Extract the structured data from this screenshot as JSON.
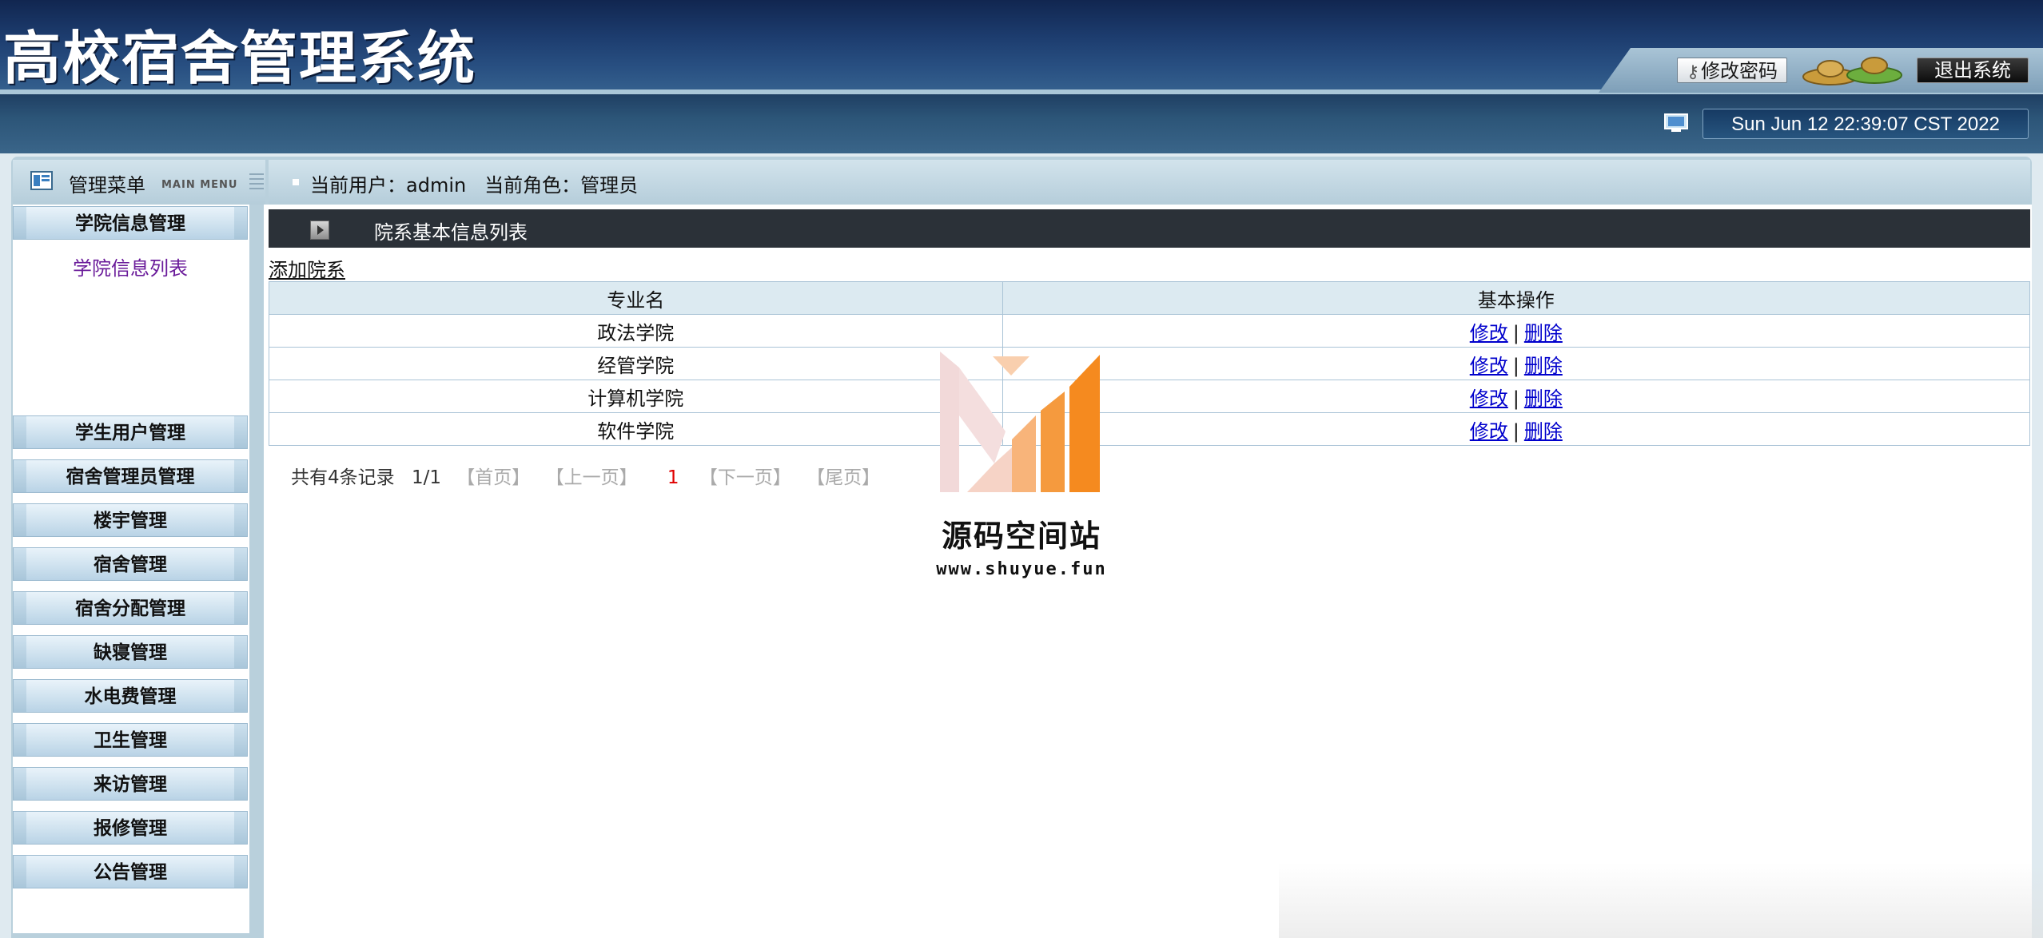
{
  "header": {
    "app_title": "高校宿舍管理系统",
    "change_password_label": "修改密码",
    "logout_label": "退出系统",
    "datetime": "Sun Jun 12 22:39:07 CST 2022"
  },
  "menu_header": {
    "label": "管理菜单",
    "sub_label": "MAIN MENU"
  },
  "user_bar": {
    "text": "当前用户：admin   当前角色：管理员"
  },
  "sidebar": {
    "groups": [
      {
        "label": "学院信息管理"
      },
      {
        "label": "学生用户管理"
      },
      {
        "label": "宿舍管理员管理"
      },
      {
        "label": "楼宇管理"
      },
      {
        "label": "宿舍管理"
      },
      {
        "label": "宿舍分配管理"
      },
      {
        "label": "缺寝管理"
      },
      {
        "label": "水电费管理"
      },
      {
        "label": "卫生管理"
      },
      {
        "label": "来访管理"
      },
      {
        "label": "报修管理"
      },
      {
        "label": "公告管理"
      }
    ],
    "expanded_item": "学院信息列表"
  },
  "content": {
    "title": "院系基本信息列表",
    "add_link": "添加院系",
    "table": {
      "headers": [
        "专业名",
        "基本操作"
      ],
      "rows": [
        {
          "name": "政法学院",
          "edit": "修改",
          "delete": "删除"
        },
        {
          "name": "经管学院",
          "edit": "修改",
          "delete": "删除"
        },
        {
          "name": "计算机学院",
          "edit": "修改",
          "delete": "删除"
        },
        {
          "name": "软件学院",
          "edit": "修改",
          "delete": "删除"
        }
      ]
    },
    "pager": {
      "total": "共有4条记录",
      "page_info": "1/1",
      "first": "【首页】",
      "prev": "【上一页】",
      "current": "1",
      "next": "【下一页】",
      "last": "【尾页】"
    }
  },
  "watermark": {
    "name": "源码空间站",
    "url": "www.shuyue.fun"
  },
  "colors": {
    "header_dark": "#112650",
    "frame": "#b9d0dc",
    "link": "#0000cc",
    "accent_orange": "#f58a1f",
    "current_page": "#e00000"
  }
}
